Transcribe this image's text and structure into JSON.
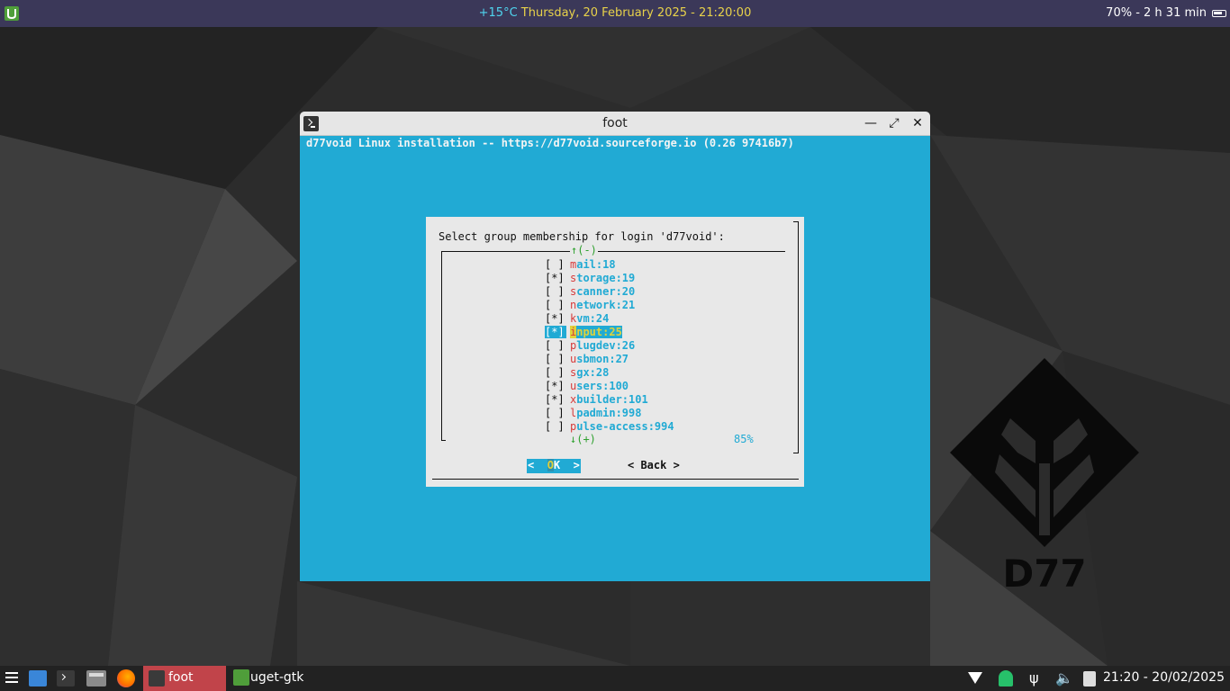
{
  "top_panel": {
    "weather": "+15°C",
    "datetime": "Thursday, 20 February 2025 - 21:20:00",
    "battery": "70% - 2 h 31 min"
  },
  "window": {
    "title": "foot",
    "header": "d77void Linux installation -- https://d77void.sourceforge.io (0.26 97416b7)"
  },
  "dialog": {
    "prompt": "Select group membership for login 'd77void':",
    "scroll_up": "↑(-)",
    "scroll_down": "↓(+)",
    "percent": "85%",
    "items": [
      {
        "check": "[ ]",
        "first": "m",
        "rest": "ail:18",
        "selected": false
      },
      {
        "check": "[*]",
        "first": "s",
        "rest": "torage:19",
        "selected": false
      },
      {
        "check": "[ ]",
        "first": "s",
        "rest": "canner:20",
        "selected": false
      },
      {
        "check": "[ ]",
        "first": "n",
        "rest": "etwork:21",
        "selected": false
      },
      {
        "check": "[*]",
        "first": "k",
        "rest": "vm:24",
        "selected": false
      },
      {
        "check": "[*]",
        "first": "i",
        "rest": "nput:25",
        "selected": true
      },
      {
        "check": "[ ]",
        "first": "p",
        "rest": "lugdev:26",
        "selected": false
      },
      {
        "check": "[ ]",
        "first": "u",
        "rest": "sbmon:27",
        "selected": false
      },
      {
        "check": "[ ]",
        "first": "s",
        "rest": "gx:28",
        "selected": false
      },
      {
        "check": "[*]",
        "first": "u",
        "rest": "sers:100",
        "selected": false
      },
      {
        "check": "[*]",
        "first": "x",
        "rest": "builder:101",
        "selected": false
      },
      {
        "check": "[ ]",
        "first": "l",
        "rest": "padmin:998",
        "selected": false
      },
      {
        "check": "[ ]",
        "first": "p",
        "rest": "ulse-access:994",
        "selected": false
      }
    ],
    "ok_left": "<  ",
    "ok_hot": "O",
    "ok_rest": "K  >",
    "back_label": "< Back >"
  },
  "logo": {
    "text": "D77"
  },
  "taskbar": {
    "tasks": [
      {
        "label": "foot",
        "active": true
      },
      {
        "label": "uget-gtk",
        "active": false
      }
    ],
    "clock": "21:20 - 20/02/2025"
  },
  "colors": {
    "terminal_bg": "#21aad4",
    "dialog_bg": "#e8e8e8",
    "panel_bg": "#3b3859",
    "taskbar_bg": "#222222",
    "active_task": "#c1444a",
    "hotkey_red": "#d63b3b",
    "highlight_yellow": "#e0d23a"
  }
}
